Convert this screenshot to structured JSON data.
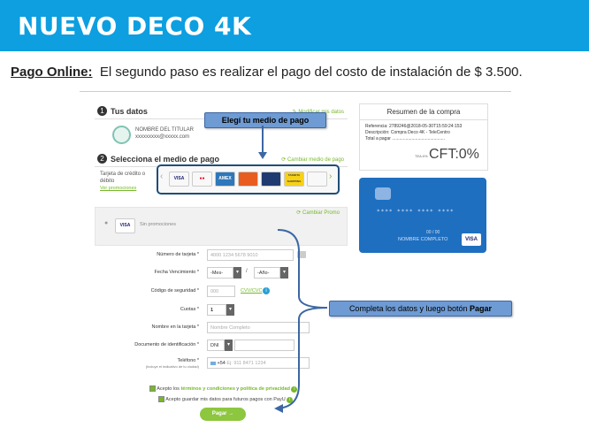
{
  "banner": {
    "title": "NUEVO DECO 4K"
  },
  "intro": {
    "label": "Pago Online:",
    "text": "El segundo paso es realizar el pago del costo de instalación de $ 3.500."
  },
  "step1": {
    "number": "1",
    "title": "Tus datos",
    "edit_link": "Modificar mis datos",
    "holder_name": "NOMBRE DEL TITULAR",
    "holder_email": "xxxxxxxxx@xxxxx.com"
  },
  "step2": {
    "number": "2",
    "title": "Selecciona el medio de pago",
    "change_link": "Cambiar medio de pago",
    "card_label": "Tarjeta de crédito o débito",
    "promos_link": "Ver promociones",
    "cards": [
      "VISA",
      "MC",
      "AMEX",
      "",
      "",
      "TARJETA SHOPPING",
      ""
    ]
  },
  "promo": {
    "card": "VISA",
    "text": "Sin promociones",
    "change_link": "Cambiar Promo"
  },
  "form": {
    "card_number_label": "Número de tarjeta *",
    "card_number_placeholder": "4000 1234 5678 9010",
    "expiry_label": "Fecha Vencimiento *",
    "month": "-Mes-",
    "sep": "/",
    "year": "-Año-",
    "cvv_label": "Código de seguridad *",
    "cvv_placeholder": "000",
    "cvv_link": "CVV/CVC",
    "installments_label": "Cuotas *",
    "installments_value": "1",
    "name_label": "Nombre en la tarjeta *",
    "name_placeholder": "Nombre Completo",
    "doc_label": "Documento de identificación *",
    "doc_type": "DNI",
    "phone_label": "Teléfono *",
    "phone_hint": "(Incluye el indicativo de tu ciudad)",
    "phone_prefix": "+54",
    "phone_placeholder": "Ej: 911 8471 1234",
    "terms_pre": "Acepto los",
    "terms_link": "términos y condiciones",
    "terms_and": "y",
    "privacy_link": "política de privacidad",
    "save_text": "Acepto guardar mis datos para futuros pagos con PayU",
    "pay_button": "Pagar →"
  },
  "summary": {
    "title": "Resumen de la compra",
    "reference": "Referencia: 2789246@2018-05-30T15:59:24:153",
    "description": "Descripción: Compra Deco 4K - TeleCentro",
    "total_label": "Total a pagar ...........................................",
    "tea": "TEA:0%",
    "cft": "CFT:0%"
  },
  "preview_card": {
    "number": "**** **** **** ****",
    "expiry": "00 / 00",
    "name": "NOMBRE COMPLETO",
    "brand": "VISA"
  },
  "callouts": {
    "payment_method": "Elegí tu medio de pago",
    "complete_pre": "Completa los datos y luego botón ",
    "complete_bold": "Pagar"
  },
  "colors": {
    "banner": "#0d9fe0",
    "accent_green": "#8dc63f",
    "callout_blue": "#6e9bd4",
    "card_blue": "#1f6fc0"
  }
}
